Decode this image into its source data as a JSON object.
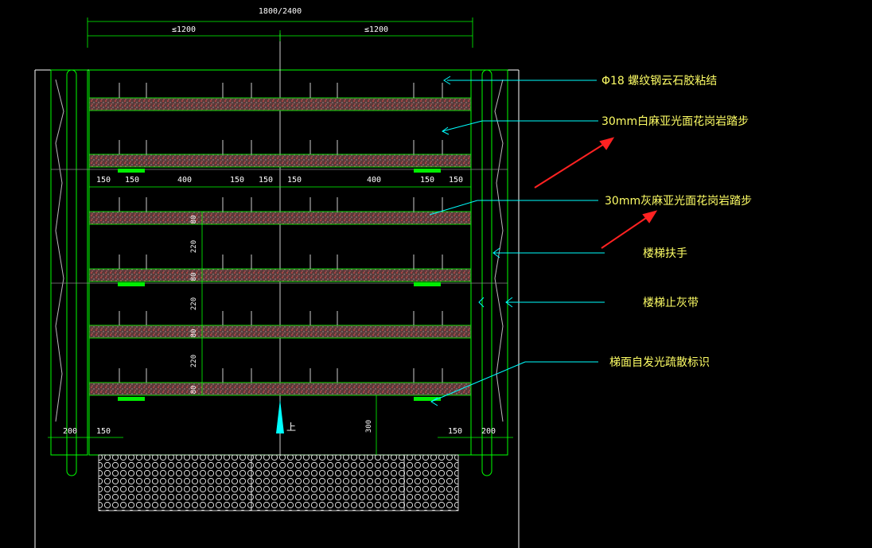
{
  "dimensions": {
    "overall": "1800/2400",
    "half_left": "≤1200",
    "half_right": "≤1200",
    "row_spacing": [
      "150",
      "150",
      "400",
      "150",
      "150",
      "150",
      "400",
      "150",
      "150"
    ],
    "riser_80_a": "80",
    "tread_220_a": "220",
    "riser_80_b": "80",
    "tread_220_b": "220",
    "riser_80_c": "80",
    "tread_220_c": "220",
    "riser_80_d": "80",
    "bottom_left_200": "200",
    "bottom_left_150": "150",
    "bottom_right_150": "150",
    "bottom_right_200": "200",
    "depth_300": "300",
    "up_label": "上"
  },
  "annotations": {
    "rebar": "Φ18 螺纹钢云石胶粘结",
    "white_granite": "30mm白麻亚光面花岗岩踏步",
    "grey_granite": "30mm灰麻亚光面花岗岩踏步",
    "handrail": "楼梯扶手",
    "ash_strip": "楼梯止灰带",
    "glow_marker": "梯面自发光疏散标识"
  },
  "colors": {
    "background": "#000000",
    "frame_line": "#00ff00",
    "wall_line": "#ffffff",
    "leader_line": "#00ffff",
    "annotation_text": "#ffff66",
    "red_arrow": "#ff2222",
    "granite_fill": "#6e4848"
  }
}
